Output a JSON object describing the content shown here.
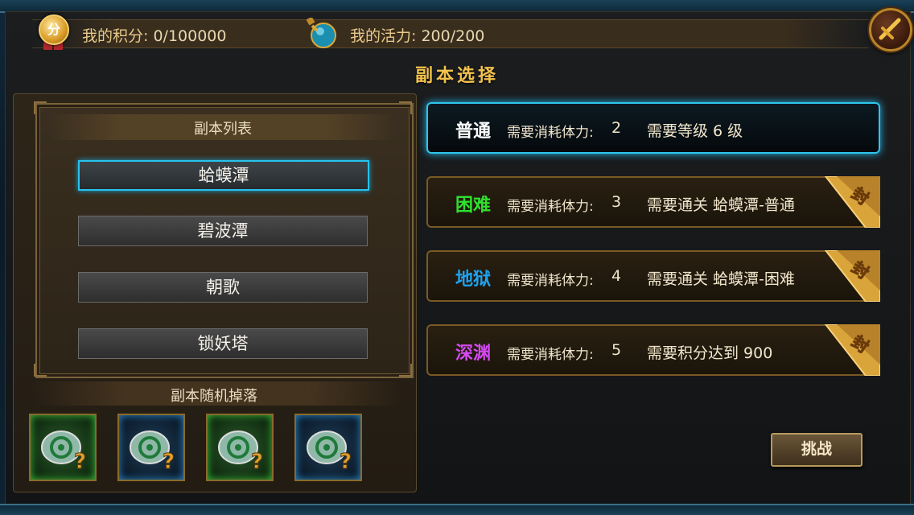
{
  "header": {
    "points_label": "我的积分:",
    "points_value": "0/100000",
    "points_icon_text": "分",
    "energy_label": "我的活力:",
    "energy_value": "200/200"
  },
  "title": "副本选择",
  "dungeon_list": {
    "title": "副本列表",
    "items": [
      {
        "label": "蛤蟆潭",
        "selected": true
      },
      {
        "label": "碧波潭",
        "selected": false
      },
      {
        "label": "朝歌",
        "selected": false
      },
      {
        "label": "锁妖塔",
        "selected": false
      }
    ]
  },
  "drops": {
    "title": "副本随机掉落",
    "slots": [
      {
        "frame": "green",
        "icon": "mystery-gem-icon"
      },
      {
        "frame": "blue",
        "icon": "mystery-gem-icon"
      },
      {
        "frame": "green",
        "icon": "mystery-gem-icon"
      },
      {
        "frame": "blue",
        "icon": "mystery-gem-icon"
      }
    ]
  },
  "difficulties": [
    {
      "name": "普通",
      "color": "#ffffff",
      "cost_label": "需要消耗体力:",
      "cost": "2",
      "requirement": "需要等级 6 级",
      "locked": false,
      "selected": true
    },
    {
      "name": "困难",
      "color": "#2fe12f",
      "cost_label": "需要消耗体力:",
      "cost": "3",
      "requirement": "需要通关 蛤蟆潭-普通",
      "locked": true,
      "lock_text": "封",
      "selected": false
    },
    {
      "name": "地狱",
      "color": "#1fa3f0",
      "cost_label": "需要消耗体力:",
      "cost": "4",
      "requirement": "需要通关 蛤蟆潭-困难",
      "locked": true,
      "lock_text": "封",
      "selected": false
    },
    {
      "name": "深渊",
      "color": "#d34bf0",
      "cost_label": "需要消耗体力:",
      "cost": "5",
      "requirement": "需要积分达到 900",
      "locked": true,
      "lock_text": "封",
      "selected": false
    }
  ],
  "challenge_button": "挑战"
}
